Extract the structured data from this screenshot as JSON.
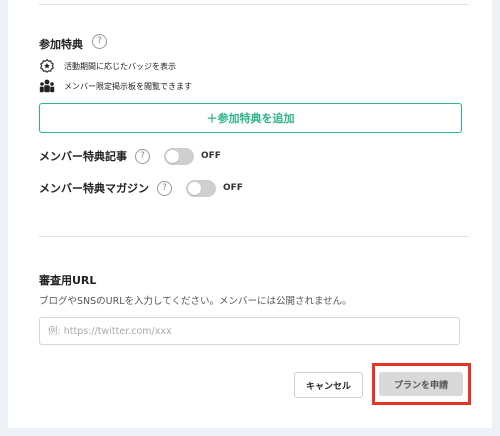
{
  "benefits": {
    "title": "参加特典",
    "items": [
      {
        "icon": "badge-icon",
        "label": "活動期間に応じたバッジを表示"
      },
      {
        "icon": "members-icon",
        "label": "メンバー限定掲示板を閲覧できます"
      }
    ],
    "add_button": "＋参加特典を追加"
  },
  "toggles": [
    {
      "label": "メンバー特典記事",
      "state": "OFF"
    },
    {
      "label": "メンバー特典マガジン",
      "state": "OFF"
    }
  ],
  "review_url": {
    "title": "審査用URL",
    "description": "ブログやSNSのURLを入力してください。メンバーには公開されません。",
    "placeholder": "例: https://twitter.com/xxx",
    "value": ""
  },
  "actions": {
    "cancel": "キャンセル",
    "apply": "プランを申請"
  },
  "help_glyph": "?",
  "colors": {
    "accent": "#2db489",
    "highlight": "#e53528",
    "apply_button_bg": "#d9d9d9",
    "toggle_off": "#cfcfcf"
  }
}
